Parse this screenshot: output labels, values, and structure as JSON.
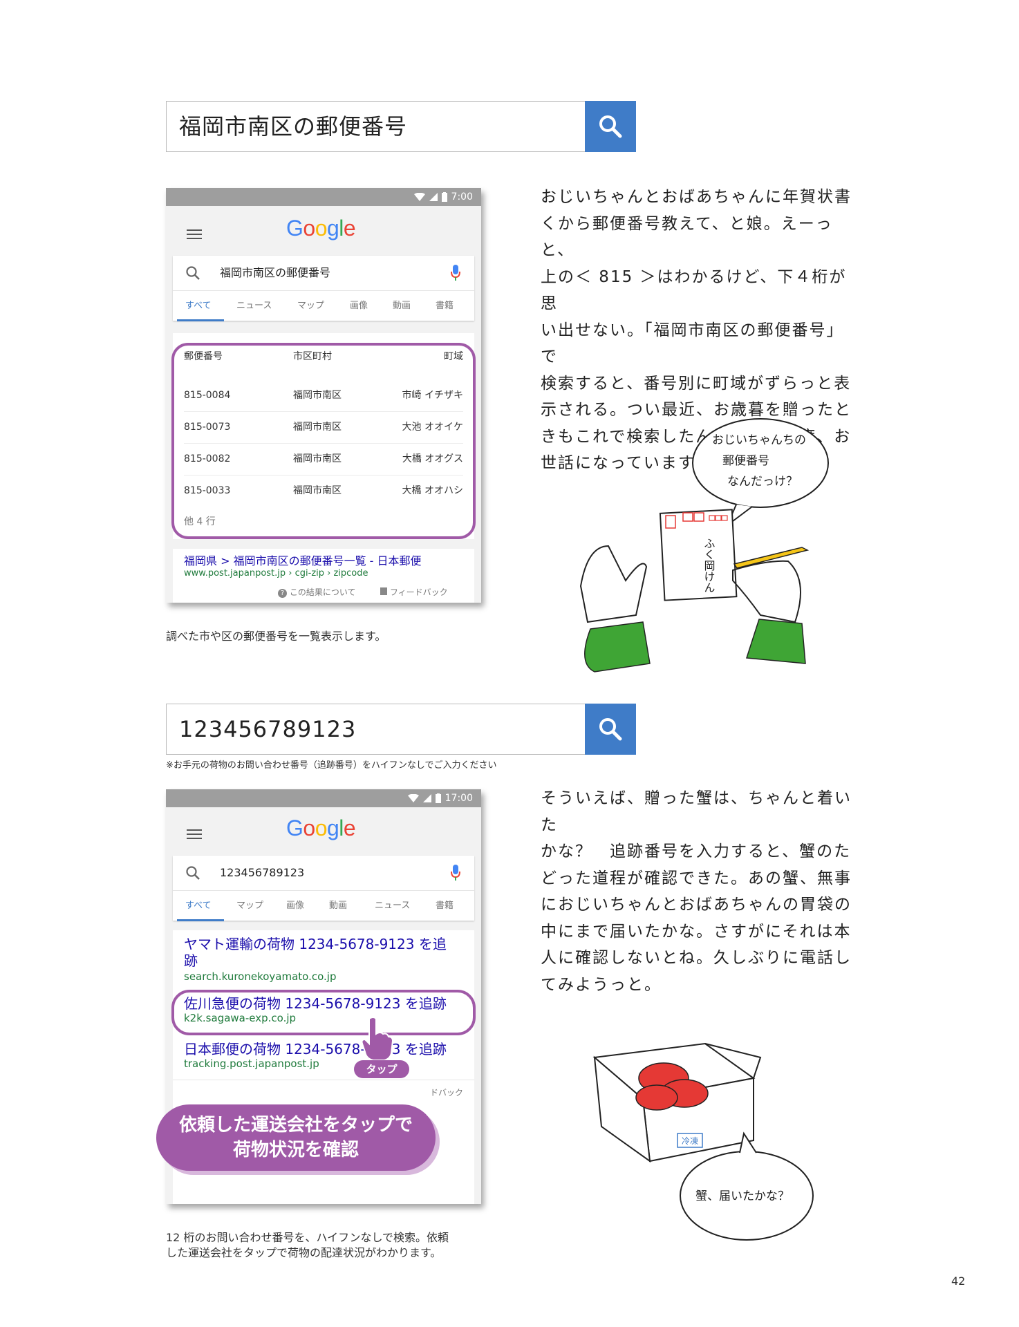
{
  "search1": {
    "query": "福岡市南区の郵便番号",
    "icon": "search-icon"
  },
  "phone1": {
    "status_time": "7:00",
    "logo": [
      "G",
      "o",
      "o",
      "g",
      "l",
      "e"
    ],
    "query": "福岡市南区の郵便番号",
    "tabs": [
      "すべて",
      "ニュース",
      "マップ",
      "画像",
      "動画",
      "書籍"
    ],
    "table_headers": [
      "郵便番号",
      "市区町村",
      "町域"
    ],
    "rows": [
      [
        "815-0084",
        "福岡市南区",
        "市崎 イチザキ"
      ],
      [
        "815-0073",
        "福岡市南区",
        "大池 オオイケ"
      ],
      [
        "815-0082",
        "福岡市南区",
        "大橋 オオグス"
      ],
      [
        "815-0033",
        "福岡市南区",
        "大橋 オオハシ"
      ]
    ],
    "more": "他 4 行",
    "result_title": "福岡県 > 福岡市南区の郵便番号一覧 - 日本郵便",
    "result_url": "www.post.japanpost.jp › cgi-zip › zipcode",
    "about": "この結果について",
    "feedback": "フィードバック"
  },
  "caption1": "調べた市や区の郵便番号を一覧表示します。",
  "body1": [
    "おじいちゃんとおばあちゃんに年賀状書",
    "くから郵便番号教えて、と娘。えーっと、",
    "上の＜ 815 ＞はわかるけど、下４桁が思",
    "い出せない。「福岡市南区の郵便番号」で",
    "検索すると、番号別に町域がずらっと表",
    "示される。つい最近、お歳暮を贈ったと",
    "きもこれで検索したんだった。毎度、お",
    "世話になっています。"
  ],
  "illus1": {
    "bubble": [
      "おじいちゃんちの",
      "郵便番号",
      "なんだっけ？"
    ],
    "card_text": "ふく岡けん"
  },
  "search2": {
    "query": "123456789123",
    "note": "※お手元の荷物のお問い合わせ番号（追跡番号）をハイフンなしでご入力ください"
  },
  "phone2": {
    "status_time": "17:00",
    "logo": [
      "G",
      "o",
      "o",
      "g",
      "l",
      "e"
    ],
    "query": "123456789123",
    "tabs": [
      "すべて",
      "マップ",
      "画像",
      "動画",
      "ニュース",
      "書籍"
    ],
    "results": [
      {
        "title_line1": "ヤマト運輸の荷物 1234-5678-9123 を追",
        "title_line2": "跡",
        "url": "search.kuronekoyamato.co.jp"
      },
      {
        "title_line1": "佐川急便の荷物 1234-5678-9123 を追跡",
        "url": "k2k.sagawa-exp.co.jp"
      },
      {
        "title_line1": "日本郵便の荷物 1234-5678-9123 を追跡",
        "url": "tracking.post.japanpost.jp"
      }
    ],
    "feedback_partial": "ドバック",
    "tap": "タップ",
    "callout": [
      "依頼した運送会社をタップで",
      "荷物状況を確認"
    ]
  },
  "caption2": [
    "12 桁のお問い合わせ番号を、ハイフンなしで検索。依頼",
    "した運送会社をタップで荷物の配達状況がわかります。"
  ],
  "body2": [
    "そういえば、贈った蟹は、ちゃんと着いた",
    "かな？　追跡番号を入力すると、蟹のた",
    "どった道程が確認できた。あの蟹、無事",
    "におじいちゃんとおばあちゃんの胃袋の",
    "中にまで届いたかな。さすがにそれは本",
    "人に確認しないとね。久しぶりに電話し",
    "てみようっと。"
  ],
  "illus2": {
    "bubble": "蟹、届いたかな？",
    "box_label": "冷凍"
  },
  "page_number": "42",
  "colors": {
    "accent_purple": "#a05aa7",
    "search_blue": "#3f7cc8",
    "link_blue": "#1a0dab",
    "url_green": "#1e7a3b"
  }
}
